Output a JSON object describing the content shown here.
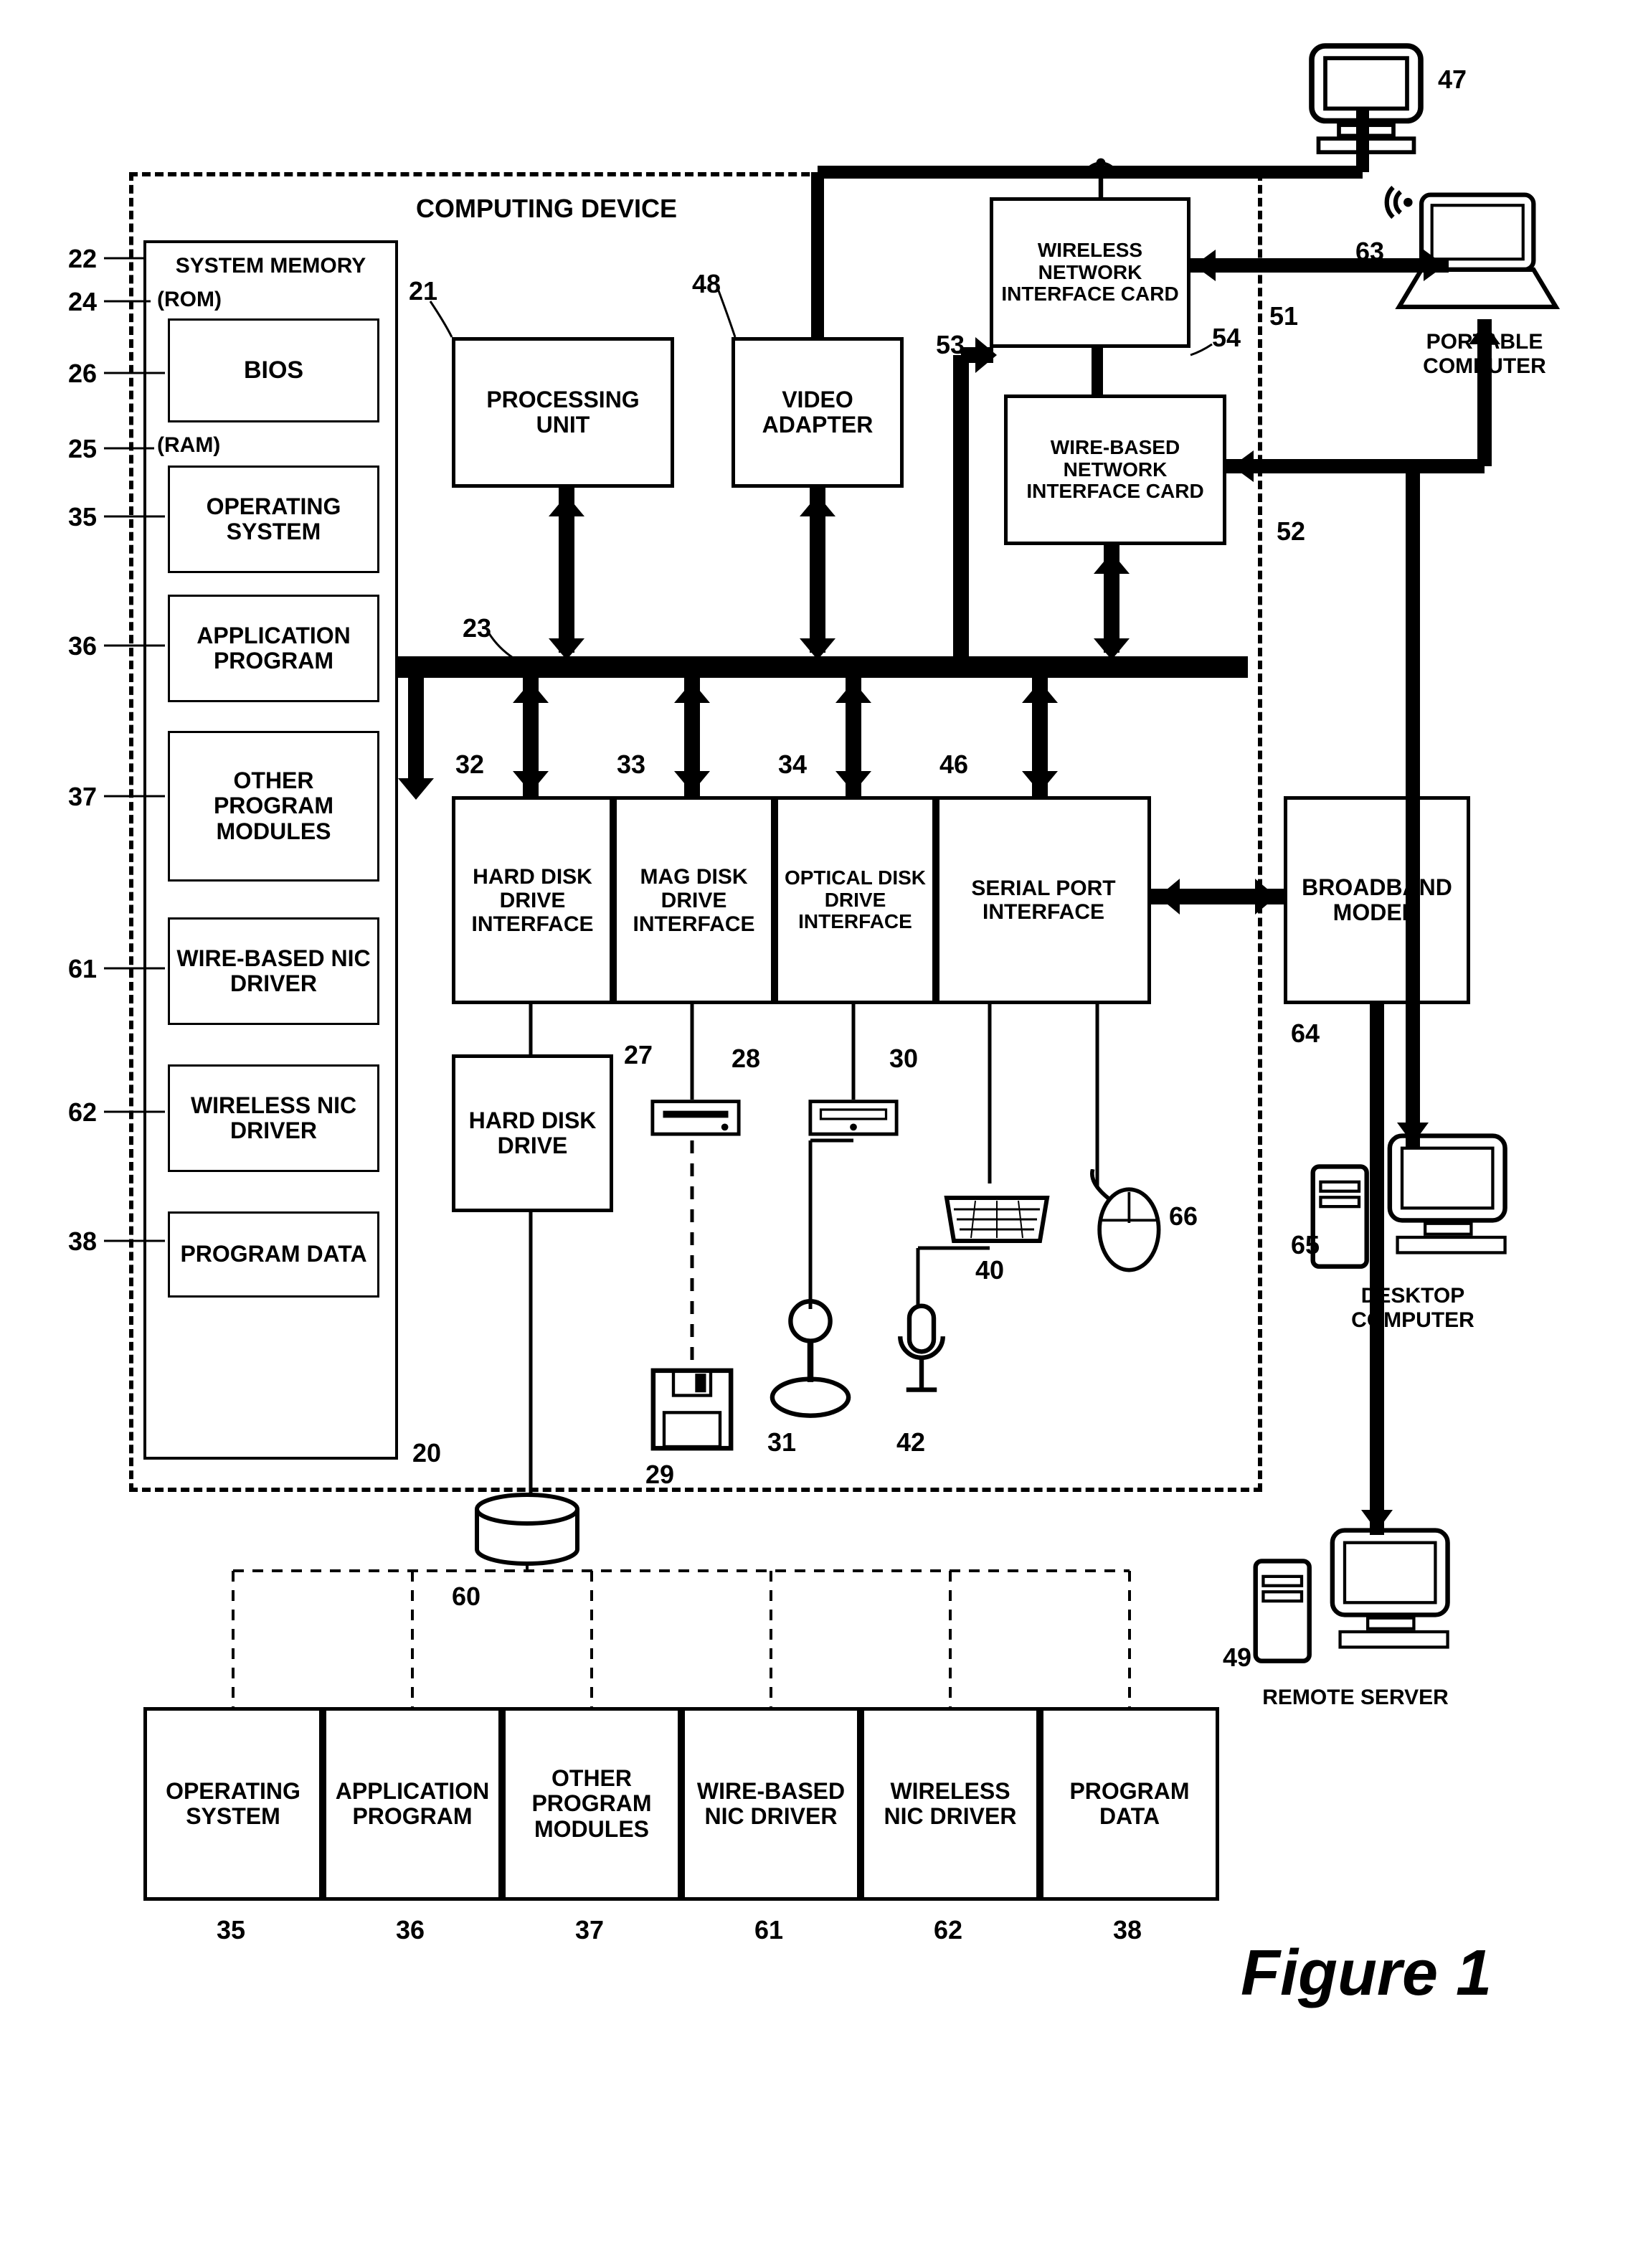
{
  "figure_title": "Figure 1",
  "device_label": "COMPUTING DEVICE",
  "system_memory": {
    "title": "SYSTEM MEMORY",
    "rom": "(ROM)",
    "bios": "BIOS",
    "ram": "(RAM)",
    "os": "OPERATING SYSTEM",
    "app": "APPLICATION PROGRAM",
    "other": "OTHER PROGRAM MODULES",
    "wire_driver": "WIRE-BASED NIC DRIVER",
    "wireless_driver": "WIRELESS NIC DRIVER",
    "pdata": "PROGRAM DATA"
  },
  "processing_unit": "PROCESSING UNIT",
  "video_adapter": "VIDEO ADAPTER",
  "wireless_nic": "WIRELESS NETWORK INTERFACE CARD",
  "wired_nic": "WIRE-BASED NETWORK INTERFACE CARD",
  "hdd_if": "HARD DISK DRIVE INTERFACE",
  "mdd_if": "MAG DISK DRIVE INTERFACE",
  "odd_if": "OPTICAL DISK DRIVE INTERFACE",
  "serial_if": "SERIAL PORT INTERFACE",
  "hdd": "HARD DISK DRIVE",
  "broadband": "BROADBAND MODEM",
  "portable": "PORTABLE COMPUTER",
  "desktop": "DESKTOP COMPUTER",
  "remote": "REMOTE SERVER",
  "storage": {
    "os": "OPERATING SYSTEM",
    "app": "APPLICATION PROGRAM",
    "other": "OTHER PROGRAM MODULES",
    "wire": "WIRE-BASED NIC DRIVER",
    "wireless": "WIRELESS NIC DRIVER",
    "pdata": "PROGRAM DATA"
  },
  "refs": {
    "r20": "20",
    "r21": "21",
    "r22": "22",
    "r23": "23",
    "r24": "24",
    "r25": "25",
    "r26": "26",
    "r27": "27",
    "r28": "28",
    "r29": "29",
    "r30": "30",
    "r31": "31",
    "r32": "32",
    "r33": "33",
    "r34": "34",
    "r35": "35",
    "r36": "36",
    "r37": "37",
    "r38": "38",
    "r40": "40",
    "r42": "42",
    "r46": "46",
    "r47": "47",
    "r48": "48",
    "r49": "49",
    "r51": "51",
    "r52": "52",
    "r53": "53",
    "r54": "54",
    "r60": "60",
    "r61": "61",
    "r62": "62",
    "r63": "63",
    "r64": "64",
    "r65": "65",
    "r66": "66",
    "r35b": "35",
    "r36b": "36",
    "r37b": "37",
    "r38b": "38",
    "r61b": "61",
    "r62b": "62"
  }
}
